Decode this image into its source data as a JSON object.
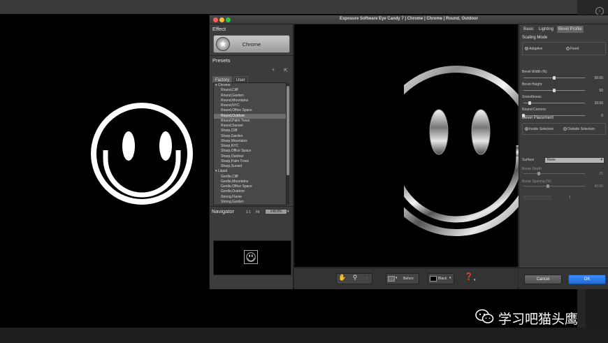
{
  "window": {
    "title": "Exposure Software Eye Candy 7 | Chrome | Chrome | Round, Outdoor",
    "traffic_lights": {
      "close": "#ff5f57",
      "minimize": "#febc2e",
      "zoom": "#28c840"
    }
  },
  "effect": {
    "section_title": "Effect",
    "name": "Chrome"
  },
  "presets": {
    "section_title": "Presets",
    "add_label": "+",
    "tabs": [
      {
        "label": "Factory",
        "active": true
      },
      {
        "label": "User",
        "active": false
      }
    ],
    "items": [
      {
        "label": "▾ Chrome",
        "level": 0,
        "selected": false
      },
      {
        "label": "Round,Cliff",
        "level": 1,
        "selected": false
      },
      {
        "label": "Round,Garden",
        "level": 1,
        "selected": false
      },
      {
        "label": "Round,Mountains",
        "level": 1,
        "selected": false
      },
      {
        "label": "Round,NYC",
        "level": 1,
        "selected": false
      },
      {
        "label": "Round,Office Space",
        "level": 1,
        "selected": false
      },
      {
        "label": "Round,Outdoor",
        "level": 1,
        "selected": true
      },
      {
        "label": "Round,Palm Trees",
        "level": 1,
        "selected": false
      },
      {
        "label": "Round,Sunset",
        "level": 1,
        "selected": false
      },
      {
        "label": "Sharp,Cliff",
        "level": 1,
        "selected": false
      },
      {
        "label": "Sharp,Garden",
        "level": 1,
        "selected": false
      },
      {
        "label": "Sharp,Mountains",
        "level": 1,
        "selected": false
      },
      {
        "label": "Sharp,NYC",
        "level": 1,
        "selected": false
      },
      {
        "label": "Sharp,Office Space",
        "level": 1,
        "selected": false
      },
      {
        "label": "Sharp,Outdoor",
        "level": 1,
        "selected": false
      },
      {
        "label": "Sharp,Palm Trees",
        "level": 1,
        "selected": false
      },
      {
        "label": "Sharp,Sunset",
        "level": 1,
        "selected": false
      },
      {
        "label": "▾ Liquid",
        "level": 0,
        "selected": false
      },
      {
        "label": "Gentle,Cliff",
        "level": 1,
        "selected": false
      },
      {
        "label": "Gentle,Mountains",
        "level": 1,
        "selected": false
      },
      {
        "label": "Gentle,Office Space",
        "level": 1,
        "selected": false
      },
      {
        "label": "Gentle,Outdoor",
        "level": 1,
        "selected": false
      },
      {
        "label": "Strong,Flame",
        "level": 1,
        "selected": false
      },
      {
        "label": "Strong,Garden",
        "level": 1,
        "selected": false
      }
    ]
  },
  "navigator": {
    "section_title": "Navigator",
    "fit_1_1": "1:1",
    "fit": "Fit",
    "zoom": "148.8%"
  },
  "settings": {
    "tabs": [
      {
        "label": "Basic",
        "active": false
      },
      {
        "label": "Lighting",
        "active": false
      },
      {
        "label": "Bevel Profile",
        "active": true
      }
    ],
    "scaling_mode": {
      "title": "Scaling Mode",
      "options": [
        {
          "label": "Adaptive",
          "selected": true
        },
        {
          "label": "Fixed",
          "selected": false
        }
      ]
    },
    "sliders": [
      {
        "label": "Bevel Width (%)",
        "value": "50.00",
        "fraction": 0.5
      },
      {
        "label": "Bevel Height",
        "value": "50",
        "fraction": 0.5
      },
      {
        "label": "Smoothness",
        "value": "10.00",
        "fraction": 0.1
      },
      {
        "label": "Round Corners",
        "value": "0",
        "fraction": 0.0
      }
    ],
    "bevel_placement": {
      "title": "Bevel Placement",
      "options": [
        {
          "label": "Inside Selection",
          "selected": true
        },
        {
          "label": "Outside Selection",
          "selected": false
        }
      ]
    },
    "surface": {
      "label": "Surface",
      "value": "None"
    },
    "dim_sliders": [
      {
        "label": "Bump Depth",
        "value": "25",
        "fraction": 0.25
      },
      {
        "label": "Bump Spacing (%)",
        "value": "40.00",
        "fraction": 0.4
      }
    ],
    "dim_value": "1"
  },
  "toolbar": {
    "hand_icon": "hand-icon",
    "zoom_icon": "magnifier-icon",
    "before_label": "Before",
    "bg_label": "Black",
    "help_icon": "help-icon"
  },
  "buttons": {
    "cancel": "Cancel",
    "ok": "OK"
  },
  "watermark": {
    "text": "学习吧猫头鹰",
    "icon": "wechat-icon"
  }
}
